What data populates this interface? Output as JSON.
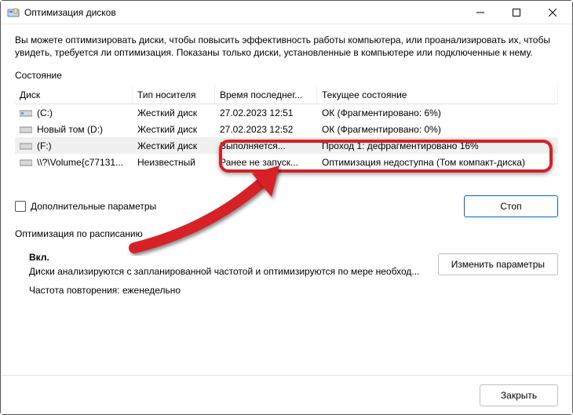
{
  "window": {
    "title": "Оптимизация дисков"
  },
  "intro": "Вы можете оптимизировать диски, чтобы повысить эффективность работы компьютера, или проанализировать их, чтобы увидеть, требуется ли оптимизация. Показаны только диски, установленные в компьютере или подключенные к нему.",
  "labels": {
    "state": "Состояние",
    "advanced": "Дополнительные параметры",
    "schedule": "Оптимизация по расписанию",
    "schedule_on": "Вкл.",
    "schedule_text": "Диски анализируются с запланированной частотой и оптимизируются по мере необход...",
    "schedule_freq_label": "Частота повторения:",
    "schedule_freq_value": "еженедельно"
  },
  "columns": {
    "disk": "Диск",
    "media": "Тип носителя",
    "last": "Время последнег...",
    "state": "Текущее состояние"
  },
  "rows": [
    {
      "disk": "(C:)",
      "media": "Жесткий диск",
      "last": "27.02.2023 12:51",
      "state": "ОК (Фрагментировано: 6%)",
      "selected": false
    },
    {
      "disk": "Новый том (D:)",
      "media": "Жесткий диск",
      "last": "27.02.2023 12:52",
      "state": "ОК (Фрагментировано: 0%)",
      "selected": false
    },
    {
      "disk": "(F:)",
      "media": "Жесткий диск",
      "last": "Выполняется...",
      "state": "Проход 1: дефрагментировано 16%",
      "selected": true
    },
    {
      "disk": "\\\\?\\Volume{c77131...",
      "media": "Неизвестный",
      "last": "Ранее не запуск...",
      "state": "Оптимизация недоступна (Том компакт-диска)",
      "selected": false
    }
  ],
  "buttons": {
    "stop": "Стоп",
    "change": "Изменить параметры",
    "close": "Закрыть"
  }
}
